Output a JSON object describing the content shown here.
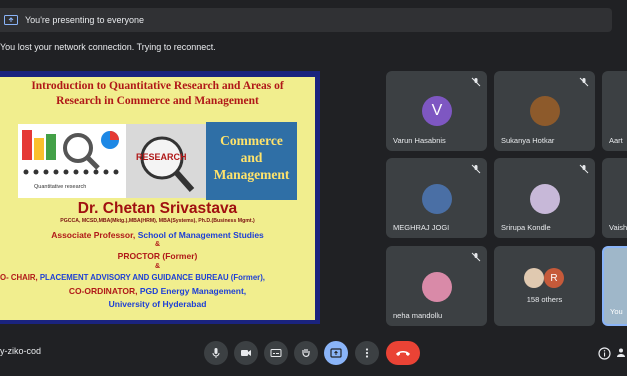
{
  "banners": {
    "presenting": "You're presenting to everyone",
    "network": "You lost your network connection. Trying to reconnect."
  },
  "slide": {
    "title_line1": "Introduction to Quantitative Research and Areas of",
    "title_line2": "Research in Commerce and Management",
    "img1_label": "Quantitative research",
    "img2_label": "RESEARCH",
    "img3_line1": "Commerce",
    "img3_line2": "and",
    "img3_line3": "Management",
    "name": "Dr. Chetan Srivastava",
    "degrees": "PGCCA, MCSD,MBA(Mktg.),MBA(HRM), MBA(Systems), Ph.D.(Business Mgmt.)",
    "role_a": "Associate Professor,",
    "role_b": "School of Management Studies",
    "amp1": "&",
    "proctor": "PROCTOR (Former)",
    "amp2": "&",
    "cochair_a": "O- CHAIR,",
    "cochair_b": "PLACEMENT ADVISORY AND GUIDANCE BUREAU (Former),",
    "coord_a": "CO-ORDINATOR,",
    "coord_b": "PGD Energy Management,",
    "university": "University of Hyderabad"
  },
  "participants": [
    {
      "name": "Varun Hasabnis",
      "initial": "V",
      "avatar_color": "#7e57c2"
    },
    {
      "name": "Sukanya Hotkar",
      "avatar_color": "#8d5a2b"
    },
    {
      "name": "Aart"
    },
    {
      "name": "MEGHRAJ JOGI",
      "avatar_color": "#4a6fa5"
    },
    {
      "name": "Srirupa Kondle",
      "avatar_color": "#c7b8d8"
    },
    {
      "name": "Vaish"
    },
    {
      "name": "neha mandollu",
      "avatar_color": "#d98aa8"
    },
    {
      "name": "158 others",
      "initial": "R",
      "avatar_color": "#c65a3a"
    },
    {
      "name": "You"
    }
  ],
  "meeting_code": "y-ziko-cod",
  "icons": [
    "mic-icon",
    "camera-icon",
    "captions-icon",
    "raise-hand-icon",
    "present-icon",
    "more-icon",
    "end-call-icon",
    "info-icon",
    "people-icon"
  ]
}
